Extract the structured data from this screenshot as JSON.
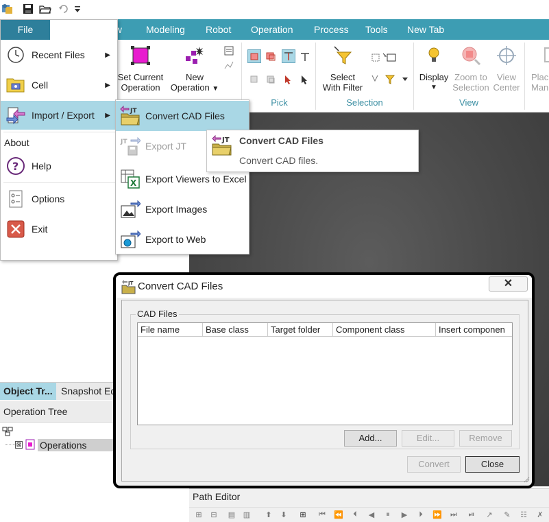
{
  "ribbon": {
    "tabs": [
      "File",
      "ew",
      "Modeling",
      "Robot",
      "Operation",
      "Process",
      "Tools",
      "New Tab"
    ],
    "buttons": {
      "set_current_operation": [
        "Set Current",
        "Operation"
      ],
      "new_operation": [
        "New",
        "Operation"
      ],
      "select_with_filter": [
        "Select",
        "With Filter"
      ],
      "display": "Display",
      "zoom_to_selection": [
        "Zoom to",
        "Selection"
      ],
      "view_center": [
        "View",
        "Center"
      ],
      "place_manip": [
        "Plac",
        "Man"
      ]
    },
    "groups": {
      "pick": "Pick",
      "selection": "Selection",
      "view": "View"
    }
  },
  "file_menu": {
    "items": [
      {
        "label": "Recent Files",
        "icon": "clock-icon",
        "submenu": true
      },
      {
        "label": "Cell",
        "icon": "cell-icon",
        "submenu": true
      },
      {
        "label": "Import / Export",
        "icon": "import-export-icon",
        "submenu": true
      },
      {
        "label": "About",
        "icon": "",
        "submenu": false
      },
      {
        "label": "Help",
        "icon": "help-icon",
        "submenu": false
      },
      {
        "label": "Options",
        "icon": "options-icon",
        "submenu": false
      },
      {
        "label": "Exit",
        "icon": "exit-icon",
        "submenu": false
      }
    ]
  },
  "submenu": {
    "items": [
      {
        "label": "Convert CAD Files",
        "enabled": true,
        "highlighted": true
      },
      {
        "label": "Export JT",
        "enabled": false
      },
      {
        "label": "Export Viewers to Excel",
        "enabled": true
      },
      {
        "label": "Export Images",
        "enabled": true
      },
      {
        "label": "Export to Web",
        "enabled": true
      }
    ]
  },
  "tooltip": {
    "title": "Convert CAD Files",
    "description": "Convert CAD files."
  },
  "left_panel": {
    "tabs": [
      "Object Tr...",
      "Snapshot Ed"
    ],
    "panel_title": "Operation Tree",
    "tree_root": "Operations"
  },
  "dialog": {
    "title": "Convert CAD Files",
    "group_label": "CAD Files",
    "columns": [
      "File name",
      "Base class",
      "Target folder",
      "Component class",
      "Insert componen"
    ],
    "buttons": {
      "add": "Add...",
      "edit": "Edit...",
      "remove": "Remove",
      "convert": "Convert",
      "close": "Close"
    }
  },
  "path_editor": {
    "title": "Path Editor"
  },
  "colors": {
    "ribbon_tab_bar": "#3d9db3",
    "file_tab": "#2e7f9b",
    "highlight": "#a9d7e5",
    "group_label": "#3c8fa3"
  }
}
